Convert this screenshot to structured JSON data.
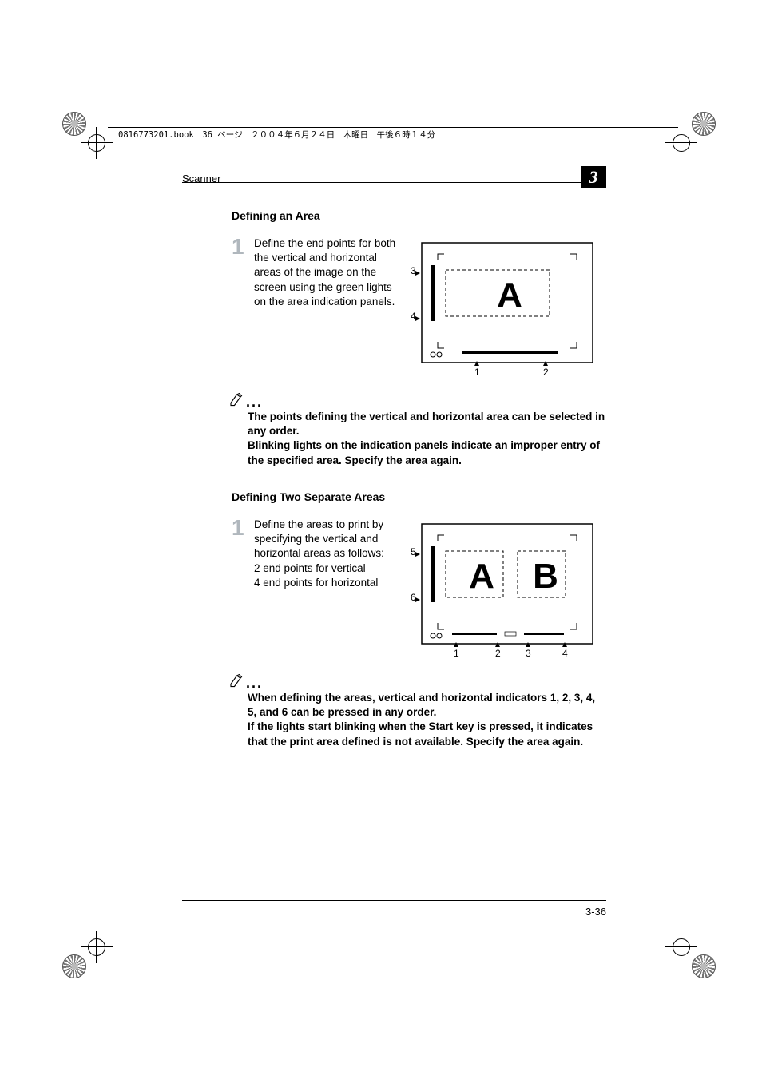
{
  "header": {
    "filename_line": "0816773201.book　36 ページ　２００４年６月２４日　木曜日　午後６時１４分",
    "section": "Scanner",
    "chapter": "3"
  },
  "section1": {
    "heading": "Defining an Area",
    "step_num": "1",
    "step_text": "Define the end points for both the vertical and horizontal areas of the image on the screen using the green lights on the area indication panels.",
    "fig": {
      "label_A": "A",
      "side_3": "3",
      "side_4": "4",
      "bot_1": "1",
      "bot_2": "2"
    },
    "note": "The points defining the vertical and horizontal area can be selected in any order.\nBlinking lights on the indication panels indicate an improper entry of the specified area. Specify the area again."
  },
  "section2": {
    "heading": "Defining Two Separate Areas",
    "step_num": "1",
    "step_text_line1": "Define the areas to print by specifying the vertical and horizontal areas as follows:",
    "step_text_line2": "2 end points for vertical",
    "step_text_line3": "4 end points for horizontal",
    "fig": {
      "label_A": "A",
      "label_B": "B",
      "side_5": "5",
      "side_6": "6",
      "bot_1": "1",
      "bot_2": "2",
      "bot_3": "3",
      "bot_4": "4"
    },
    "note": "When defining the areas, vertical and horizontal indicators 1, 2, 3, 4, 5, and 6 can be pressed in any order.\nIf the lights start blinking when the Start key is pressed, it indicates that the print area defined is not available. Specify the area again."
  },
  "footer": {
    "page": "3-36"
  }
}
